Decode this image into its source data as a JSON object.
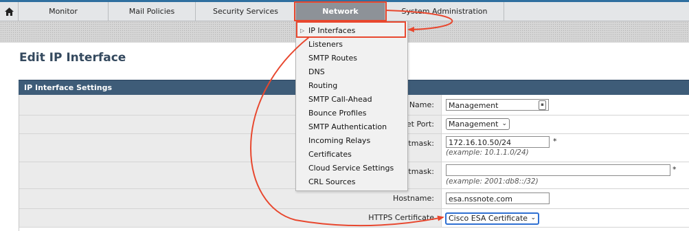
{
  "nav": {
    "tabs": [
      {
        "label": "Monitor"
      },
      {
        "label": "Mail Policies"
      },
      {
        "label": "Security Services"
      },
      {
        "label": "Network"
      },
      {
        "label": "System Administration"
      }
    ]
  },
  "page": {
    "title": "Edit IP Interface"
  },
  "section": {
    "title": "IP Interface Settings"
  },
  "menu": {
    "items": [
      {
        "label": "IP Interfaces"
      },
      {
        "label": "Listeners"
      },
      {
        "label": "SMTP Routes"
      },
      {
        "label": "DNS"
      },
      {
        "label": "Routing"
      },
      {
        "label": "SMTP Call-Ahead"
      },
      {
        "label": "Bounce Profiles"
      },
      {
        "label": "SMTP Authentication"
      },
      {
        "label": "Incoming Relays"
      },
      {
        "label": "Certificates"
      },
      {
        "label": "Cloud Service Settings"
      },
      {
        "label": "CRL Sources"
      }
    ]
  },
  "form": {
    "name": {
      "label": "Name:",
      "value": "Management"
    },
    "port": {
      "label": "et Port:",
      "value": "Management"
    },
    "ipv4": {
      "label": "etmask:",
      "value": "172.16.10.50/24",
      "example": "(example: 10.1.1.0/24)",
      "required": "*"
    },
    "ipv6": {
      "label": "etmask:",
      "value": "",
      "example": "(example: 2001:db8::/32)",
      "required": "*"
    },
    "hostname": {
      "label": "Hostname:",
      "value": "esa.nssnote.com"
    },
    "https_cert": {
      "label": "HTTPS Certificate",
      "value": "Cisco ESA Certificate"
    }
  },
  "colors": {
    "annotation": "#e8472e",
    "header": "#3e5c78",
    "active_tab": "#8d9298"
  }
}
